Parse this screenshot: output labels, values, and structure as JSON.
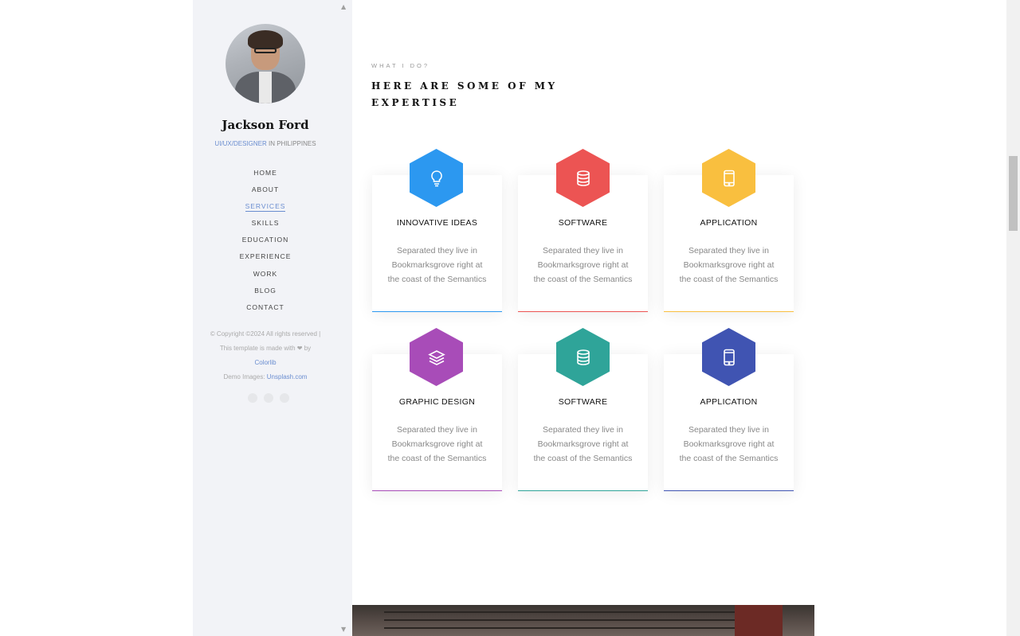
{
  "sidebar": {
    "name": "Jackson Ford",
    "role_accent": "UI/UX/DESIGNER",
    "role_rest": " IN PHILIPPINES",
    "nav": [
      "HOME",
      "ABOUT",
      "SERVICES",
      "SKILLS",
      "EDUCATION",
      "EXPERIENCE",
      "WORK",
      "BLOG",
      "CONTACT"
    ],
    "active_nav": "SERVICES",
    "copyright_line1": "© Copyright ©2024 All rights reserved |",
    "copyright_line2": "This template is made with ❤ by",
    "copyright_link": "Colorlib",
    "demo_label": "Demo Images: ",
    "demo_link": "Unsplash.com"
  },
  "section": {
    "eyebrow": "WHAT I DO?",
    "heading": "HERE ARE SOME OF MY EXPERTISE"
  },
  "services": [
    {
      "title": "INNOVATIVE IDEAS",
      "text": "Separated they live in Bookmarksgrove right at the coast of the Semantics",
      "color": "#2c98f0",
      "icon": "lightbulb-icon"
    },
    {
      "title": "SOFTWARE",
      "text": "Separated they live in Bookmarksgrove right at the coast of the Semantics",
      "color": "#ec5453",
      "icon": "database-icon"
    },
    {
      "title": "APPLICATION",
      "text": "Separated they live in Bookmarksgrove right at the coast of the Semantics",
      "color": "#f9bf3f",
      "icon": "mobile-icon"
    },
    {
      "title": "GRAPHIC DESIGN",
      "text": "Separated they live in Bookmarksgrove right at the coast of the Semantics",
      "color": "#a84cb8",
      "icon": "layers-icon"
    },
    {
      "title": "SOFTWARE",
      "text": "Separated they live in Bookmarksgrove right at the coast of the Semantics",
      "color": "#2fa499",
      "icon": "database-icon"
    },
    {
      "title": "APPLICATION",
      "text": "Separated they live in Bookmarksgrove right at the coast of the Semantics",
      "color": "#4054b2",
      "icon": "mobile-icon"
    }
  ]
}
